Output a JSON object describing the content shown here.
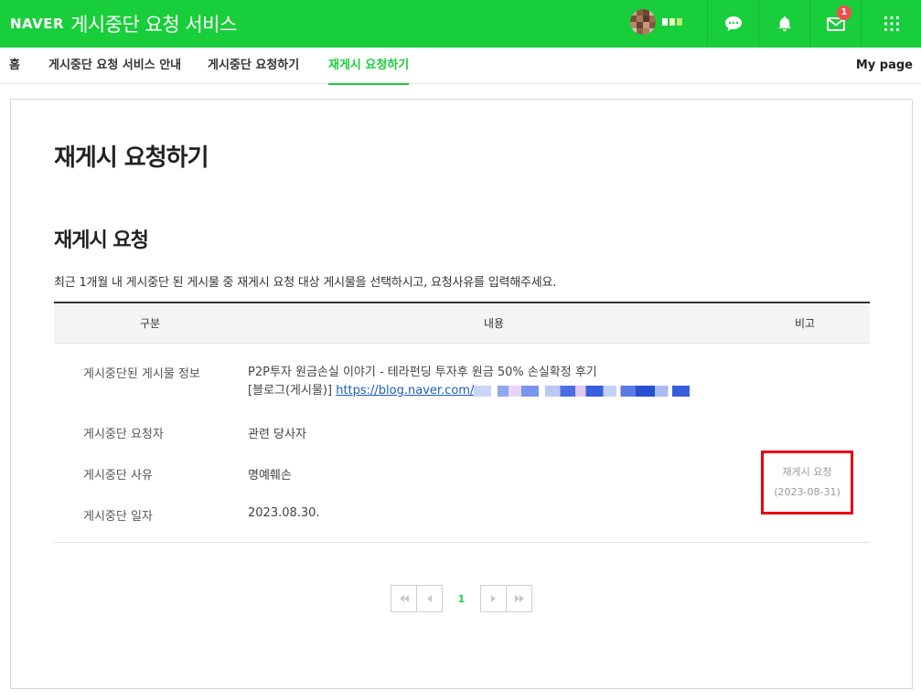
{
  "header": {
    "logo": "NAVER",
    "title": "게시중단 요청 서비스",
    "notifications": {
      "mail_count": "1"
    },
    "colors": {
      "brand": "#19ce3b",
      "badge": "#f14c4c"
    }
  },
  "nav": {
    "items": [
      {
        "label": "홈"
      },
      {
        "label": "게시중단 요청 서비스 안내"
      },
      {
        "label": "게시중단 요청하기"
      },
      {
        "label": "재게시 요청하기",
        "active": true
      }
    ],
    "mypage": "My page"
  },
  "main": {
    "page_title": "재게시 요청하기",
    "section_title": "재게시 요청",
    "description": "최근 1개월 내 게시중단 된 게시물 중 재게시 요청 대상 게시물을 선택하시고, 요청사유를 입력해주세요.",
    "table": {
      "headers": [
        "구분",
        "내용",
        "비고"
      ],
      "rows": [
        {
          "label": "게시중단된 게시물 정보",
          "post_title": "P2P투자 원금손실 이야기 - 테라펀딩 투자후 원금 50% 손실확정 후기",
          "post_type": "[블로그(게시물)]",
          "post_url": "https://blog.naver.com/"
        },
        {
          "label": "게시중단 요청자",
          "value": "관련 당사자"
        },
        {
          "label": "게시중단 사유",
          "value": "명예훼손"
        },
        {
          "label": "게시중단 일자",
          "value": "2023.08.30."
        }
      ],
      "remark": {
        "status": "재게시 요청",
        "date": "(2023-08-31)",
        "highlight_color": "#e60012"
      }
    },
    "pagination": {
      "current_page": "1"
    }
  }
}
